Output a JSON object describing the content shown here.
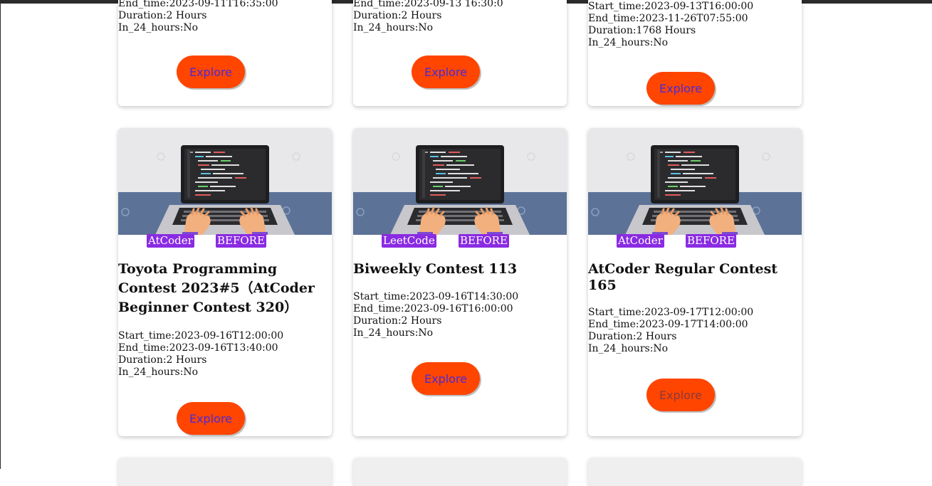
{
  "colors": {
    "badge": "#8a2be2",
    "explore_button": "#ff4500",
    "explore_text": "#4a2bd6"
  },
  "top_cards": [
    {
      "partial_lines": [
        "End_time:2023-09-11T16:35:00",
        "Duration:2 Hours",
        "In_24_hours:No"
      ],
      "explore": "Explore"
    },
    {
      "partial_lines": [
        "End_time:2023-09-13 16:30:0",
        "Duration:2 Hours",
        "In_24_hours:No"
      ],
      "explore": "Explore"
    },
    {
      "partial_lines": [
        "Start_time:2023-09-13T16:00:00",
        "End_time:2023-11-26T07:55:00",
        "Duration:1768 Hours",
        "In_24_hours:No"
      ],
      "explore": "Explore"
    }
  ],
  "cards": [
    {
      "platform": "AtCoder",
      "status": "BEFORE",
      "title": "Toyota Programming Contest 2023#5（AtCoder Beginner Contest 320）",
      "start": "Start_time:2023-09-16T12:00:00",
      "end": "End_time:2023-09-16T13:40:00",
      "duration": "Duration:2 Hours",
      "in24": "In_24_hours:No",
      "explore": "Explore"
    },
    {
      "platform": "LeetCode",
      "status": "BEFORE",
      "title": "Biweekly Contest 113",
      "start": "Start_time:2023-09-16T14:30:00",
      "end": "End_time:2023-09-16T16:00:00",
      "duration": "Duration:2 Hours",
      "in24": "In_24_hours:No",
      "explore": "Explore"
    },
    {
      "platform": "AtCoder",
      "status": "BEFORE",
      "title": "AtCoder Regular Contest 165",
      "start": "Start_time:2023-09-17T12:00:00",
      "end": "End_time:2023-09-17T14:00:00",
      "duration": "Duration:2 Hours",
      "in24": "In_24_hours:No",
      "explore": "Explore"
    }
  ]
}
